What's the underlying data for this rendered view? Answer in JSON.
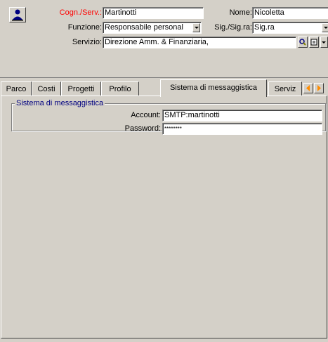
{
  "header": {
    "cogn_label": "Cogn./Serv.:",
    "cogn_value": "Martinotti",
    "nome_label": "Nome:",
    "nome_value": "Nicoletta",
    "funzione_label": "Funzione:",
    "funzione_value": "Responsabile personal",
    "sig_label": "Sig./Sig.ra:",
    "sig_value": "Sig.ra",
    "servizio_label": "Servizio:",
    "servizio_value": "Direzione Amm. & Finanziaria,"
  },
  "tabs": [
    {
      "label": "Parco"
    },
    {
      "label": "Costi"
    },
    {
      "label": "Progetti"
    },
    {
      "label": "Profilo"
    },
    {
      "label": "Sistema di messaggistica"
    },
    {
      "label": "Serviz"
    }
  ],
  "messaging": {
    "group_title": "Sistema di messaggistica",
    "account_label": "Account:",
    "account_value": "SMTP:martinotti",
    "password_label": "Password:",
    "password_value": "********"
  },
  "colors": {
    "background": "#d4d0c8",
    "required_label": "#ff0000",
    "group_title": "#000080",
    "tab_arrow": "#ff8c00"
  },
  "icons": {
    "user": "user-icon",
    "search": "magnifier-icon",
    "detail": "detail-icon"
  }
}
